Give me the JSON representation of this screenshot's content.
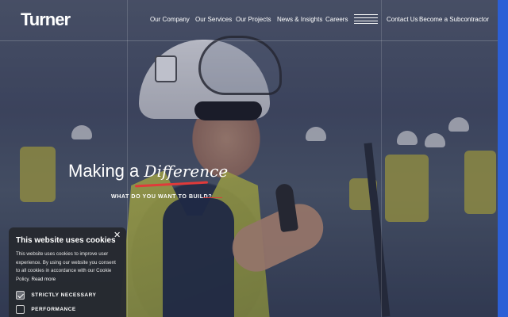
{
  "header": {
    "logo_text": "Turner",
    "nav": [
      {
        "label": "Our Company"
      },
      {
        "label": "Our Services"
      },
      {
        "label": "Our Projects"
      },
      {
        "label": "News & Insights"
      },
      {
        "label": "Careers"
      }
    ],
    "menu_icon": "hamburger-menu-icon",
    "secondary_nav": [
      {
        "label": "Contact Us"
      },
      {
        "label": "Become a Subcontractor"
      }
    ]
  },
  "hero": {
    "headline_prefix": "Making a",
    "headline_script": "Difference",
    "cta": "WHAT DO YOU WANT TO BUILD?"
  },
  "cookie_banner": {
    "title": "This website uses cookies",
    "close_icon": "close-icon",
    "body": "This website uses cookies to improve user experience. By using our website you consent to all cookies in accordance with our Cookie Policy.",
    "read_more": "Read more",
    "options": [
      {
        "label": "STRICTLY NECESSARY",
        "checked": true
      },
      {
        "label": "PERFORMANCE",
        "checked": false
      }
    ]
  },
  "colors": {
    "accent_blue": "#2b5fd6",
    "accent_red": "#e03a3a"
  }
}
